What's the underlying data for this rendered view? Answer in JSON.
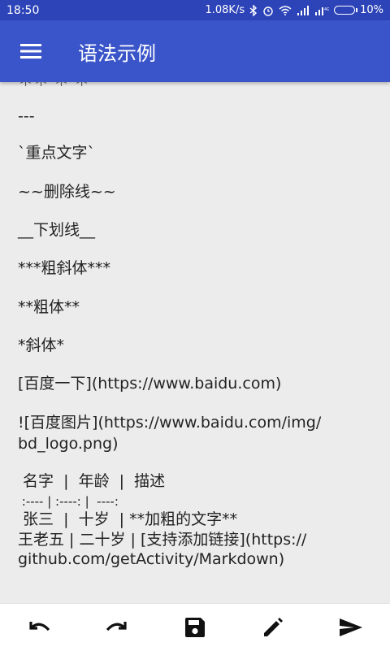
{
  "status": {
    "time": "18:50",
    "net_speed": "1.08K/s",
    "icons": [
      "bluetooth-icon",
      "alarm-icon",
      "wifi-icon",
      "signal-icon",
      "signal-4g-icon"
    ],
    "battery": "10%"
  },
  "appbar": {
    "title": "语法示例",
    "menu_icon": "hamburger-menu-icon"
  },
  "content": {
    "partial_top": "＊＊ ＊ ＊",
    "lines": [
      "---",
      "`重点文字`",
      "~~删除线~~",
      "__下划线__",
      "***粗斜体***",
      "**粗体**",
      "*斜体*",
      "[百度一下](https://www.baidu.com)",
      "![百度图片](https://www.baidu.com/img/",
      "bd_logo.png)",
      " 名字  |  年龄  |  描述",
      " :---- | :----: |  ----:",
      " 张三  |  十岁  | **加粗的文字**",
      "王老五 | 二十岁 | [支持添加链接](https://",
      "github.com/getActivity/Markdown)"
    ]
  },
  "toolbar": [
    "undo-icon",
    "redo-icon",
    "save-icon",
    "edit-icon",
    "send-icon"
  ]
}
